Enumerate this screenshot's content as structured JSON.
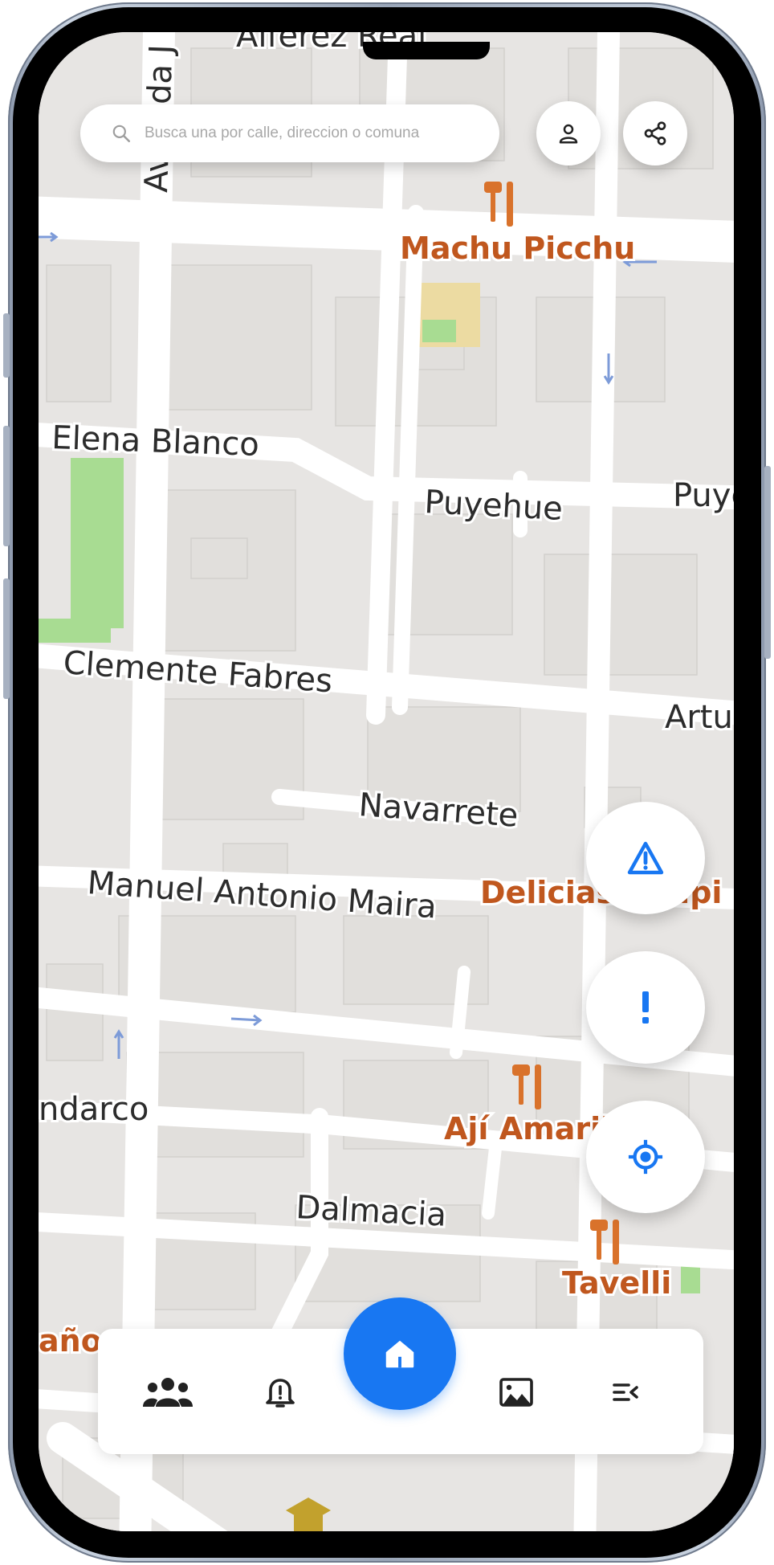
{
  "search": {
    "placeholder": "Busca una por calle, direccion o comuna"
  },
  "map": {
    "streets": [
      "Alferez Real",
      "Avenida J",
      "Elena Blanco",
      "Puyehue",
      "Puye",
      "Clemente Fabres",
      "Artu",
      "Navarrete",
      "Manuel Antonio Maira",
      "ndarco",
      "Dalmacia",
      "año"
    ],
    "pois": [
      "Machu Picchu",
      "Delicias d",
      "tipi",
      "Ají Amaril",
      "Tavelli"
    ]
  },
  "colors": {
    "accent": "#1877f2",
    "poi_label": "#c0571e",
    "map_background": "#e7e5e3",
    "road": "#ffffff"
  },
  "icons": {
    "search": "magnifier",
    "profile": "person",
    "share": "share-nodes",
    "hazard": "warning-triangle",
    "alert": "exclamation",
    "locate": "crosshair",
    "community": "people-group",
    "notifications": "bell-alert",
    "home": "house",
    "gallery": "image",
    "menu": "collapse-list"
  }
}
